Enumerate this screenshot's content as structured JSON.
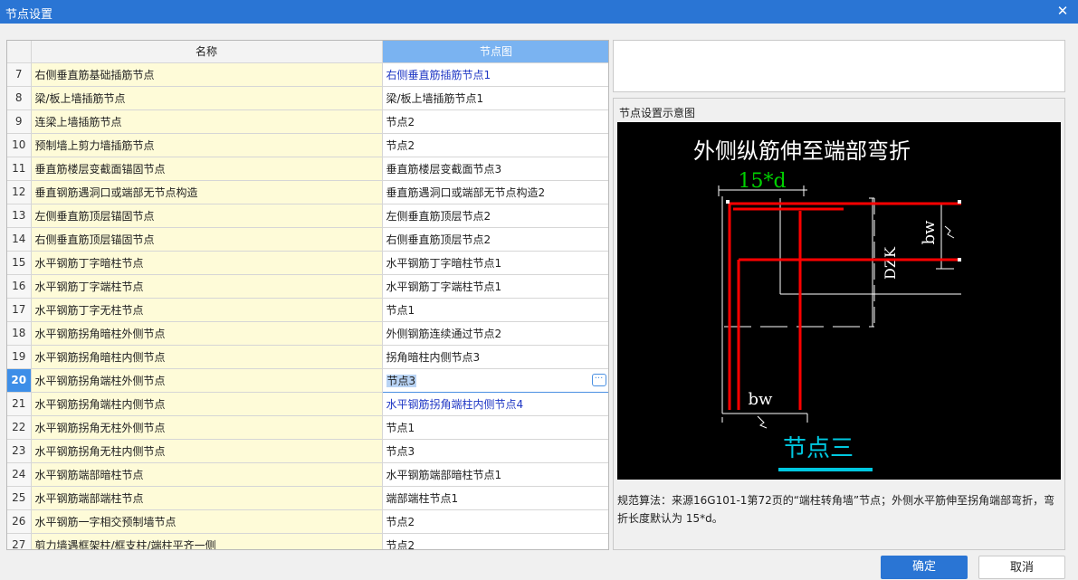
{
  "window": {
    "title": "节点设置",
    "close_glyph": "✕"
  },
  "grid": {
    "columns": {
      "name": "名称",
      "node": "节点图"
    },
    "rows": [
      {
        "num": "7",
        "name": "右侧垂直筋基础插筋节点",
        "node": "右侧垂直筋插筋节点1",
        "blue": true
      },
      {
        "num": "8",
        "name": "梁/板上墙插筋节点",
        "node": "梁/板上墙插筋节点1"
      },
      {
        "num": "9",
        "name": "连梁上墙插筋节点",
        "node": "节点2"
      },
      {
        "num": "10",
        "name": "预制墙上剪力墙插筋节点",
        "node": "节点2"
      },
      {
        "num": "11",
        "name": "垂直筋楼层变截面锚固节点",
        "node": "垂直筋楼层变截面节点3"
      },
      {
        "num": "12",
        "name": "垂直钢筋遇洞口或端部无节点构造",
        "node": "垂直筋遇洞口或端部无节点构造2"
      },
      {
        "num": "13",
        "name": "左侧垂直筋顶层锚固节点",
        "node": "左侧垂直筋顶层节点2"
      },
      {
        "num": "14",
        "name": "右侧垂直筋顶层锚固节点",
        "node": "右侧垂直筋顶层节点2"
      },
      {
        "num": "15",
        "name": "水平钢筋丁字暗柱节点",
        "node": "水平钢筋丁字暗柱节点1"
      },
      {
        "num": "16",
        "name": "水平钢筋丁字端柱节点",
        "node": "水平钢筋丁字端柱节点1"
      },
      {
        "num": "17",
        "name": "水平钢筋丁字无柱节点",
        "node": "节点1"
      },
      {
        "num": "18",
        "name": "水平钢筋拐角暗柱外侧节点",
        "node": "外侧钢筋连续通过节点2"
      },
      {
        "num": "19",
        "name": "水平钢筋拐角暗柱内侧节点",
        "node": "拐角暗柱内侧节点3"
      },
      {
        "num": "20",
        "name": "水平钢筋拐角端柱外侧节点",
        "node": "节点3",
        "selected": true
      },
      {
        "num": "21",
        "name": "水平钢筋拐角端柱内侧节点",
        "node": "水平钢筋拐角端柱内侧节点4",
        "blue": true
      },
      {
        "num": "22",
        "name": "水平钢筋拐角无柱外侧节点",
        "node": "节点1"
      },
      {
        "num": "23",
        "name": "水平钢筋拐角无柱内侧节点",
        "node": "节点3"
      },
      {
        "num": "24",
        "name": "水平钢筋端部暗柱节点",
        "node": "水平钢筋端部暗柱节点1"
      },
      {
        "num": "25",
        "name": "水平钢筋端部端柱节点",
        "node": "端部端柱节点1"
      },
      {
        "num": "26",
        "name": "水平钢筋一字相交预制墙节点",
        "node": "节点2"
      },
      {
        "num": "27",
        "name": "剪力墙遇框架柱/框支柱/端柱平齐一侧",
        "node": "节点2"
      }
    ]
  },
  "preview": {
    "title": "节点设置示意图",
    "diagram": {
      "heading": "外侧纵筋伸至端部弯折",
      "dim_top": "15*d",
      "dim_bw_right": "bw",
      "dim_dzk": "DZK",
      "dim_bw_bottom": "bw",
      "caption": "节点三"
    },
    "description": "规范算法：来源16G101-1第72页的“端柱转角墙”节点；外侧水平筋伸至拐角端部弯折，弯折长度默认为 15*d。"
  },
  "buttons": {
    "ok": "确定",
    "cancel": "取消"
  },
  "colors": {
    "accent": "#2a75d4",
    "rebar": "#ff0000",
    "diagram_green": "#00d000",
    "diagram_caption": "#00c8e0",
    "link_blue": "#1f37c4"
  }
}
